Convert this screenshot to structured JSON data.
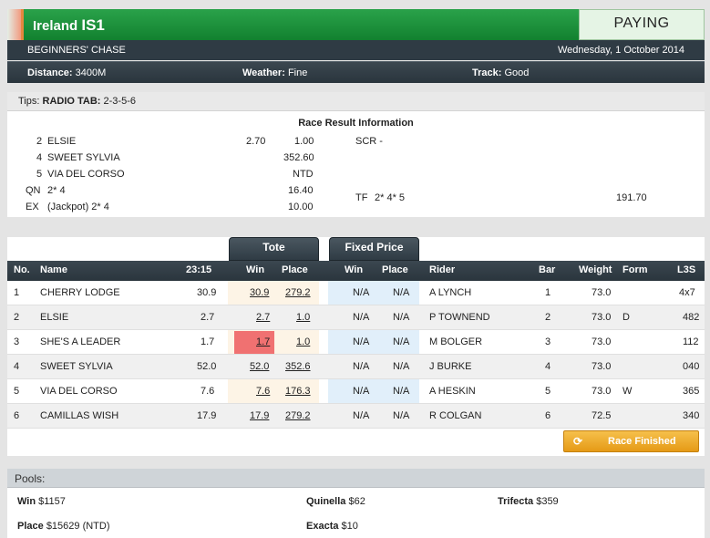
{
  "header": {
    "venue": "Ireland",
    "code": "IS1",
    "status": "PAYING",
    "race_name": "BEGINNERS' CHASE",
    "date": "Wednesday, 1 October 2014",
    "distance_label": "Distance:",
    "distance": "3400M",
    "weather_label": "Weather:",
    "weather": "Fine",
    "track_label": "Track:",
    "track": "Good"
  },
  "tips": {
    "label": "Tips:",
    "source": "RADIO TAB:",
    "value": "2-3-5-6"
  },
  "results": {
    "title": "Race Result Information",
    "placings": [
      {
        "no": "2",
        "name": "ELSIE",
        "win": "2.70",
        "place": "1.00"
      },
      {
        "no": "4",
        "name": "SWEET SYLVIA",
        "win": "",
        "place": "352.60"
      },
      {
        "no": "5",
        "name": "VIA DEL CORSO",
        "win": "",
        "place": "NTD"
      }
    ],
    "scr_label": "SCR -",
    "qn": {
      "label": "QN",
      "combo": "2* 4",
      "value": "16.40"
    },
    "ex": {
      "label": "EX",
      "combo": "(Jackpot) 2* 4",
      "value": "10.00"
    },
    "tf": {
      "label": "TF",
      "combo": "2* 4* 5",
      "value": "191.70"
    }
  },
  "runners": {
    "tabs": {
      "tote": "Tote",
      "fixed": "Fixed Price"
    },
    "columns": {
      "no": "No.",
      "name": "Name",
      "time": "23:15",
      "win": "Win",
      "place": "Place",
      "fwin": "Win",
      "fplace": "Place",
      "rider": "Rider",
      "bar": "Bar",
      "weight": "Weight",
      "form": "Form",
      "l3s": "L3S"
    },
    "rows": [
      {
        "no": "1",
        "name": "CHERRY LODGE",
        "time": "30.9",
        "win": "30.9",
        "place": "279.2",
        "fwin": "N/A",
        "fplace": "N/A",
        "rider": "A LYNCH",
        "bar": "1",
        "weight": "73.0",
        "form": "",
        "l3s": "4x7"
      },
      {
        "no": "2",
        "name": "ELSIE",
        "time": "2.7",
        "win": "2.7",
        "place": "1.0",
        "fwin": "N/A",
        "fplace": "N/A",
        "rider": "P TOWNEND",
        "bar": "2",
        "weight": "73.0",
        "form": "D",
        "l3s": "482"
      },
      {
        "no": "3",
        "name": "SHE'S A LEADER",
        "time": "1.7",
        "win": "1.7",
        "place": "1.0",
        "fwin": "N/A",
        "fplace": "N/A",
        "rider": "M BOLGER",
        "bar": "3",
        "weight": "73.0",
        "form": "",
        "l3s": "112"
      },
      {
        "no": "4",
        "name": "SWEET SYLVIA",
        "time": "52.0",
        "win": "52.0",
        "place": "352.6",
        "fwin": "N/A",
        "fplace": "N/A",
        "rider": "J BURKE",
        "bar": "4",
        "weight": "73.0",
        "form": "",
        "l3s": "040"
      },
      {
        "no": "5",
        "name": "VIA DEL CORSO",
        "time": "7.6",
        "win": "7.6",
        "place": "176.3",
        "fwin": "N/A",
        "fplace": "N/A",
        "rider": "A HESKIN",
        "bar": "5",
        "weight": "73.0",
        "form": "W",
        "l3s": "365"
      },
      {
        "no": "6",
        "name": "CAMILLAS WISH",
        "time": "17.9",
        "win": "17.9",
        "place": "279.2",
        "fwin": "N/A",
        "fplace": "N/A",
        "rider": "R COLGAN",
        "bar": "6",
        "weight": "72.5",
        "form": "",
        "l3s": "340"
      }
    ],
    "finished_label": "Race Finished"
  },
  "pools": {
    "title": "Pools:",
    "win": {
      "label": "Win",
      "value": "$1157"
    },
    "quinella": {
      "label": "Quinella",
      "value": "$62"
    },
    "trifecta": {
      "label": "Trifecta",
      "value": "$359"
    },
    "place": {
      "label": "Place",
      "value": "$15629 (NTD)"
    },
    "exacta": {
      "label": "Exacta",
      "value": "$10"
    }
  },
  "colors": {
    "accent_green": "#12812f",
    "dark_bar": "#2f3b44",
    "highlight_red": "#f07171",
    "finished_orange": "#e59a16"
  }
}
